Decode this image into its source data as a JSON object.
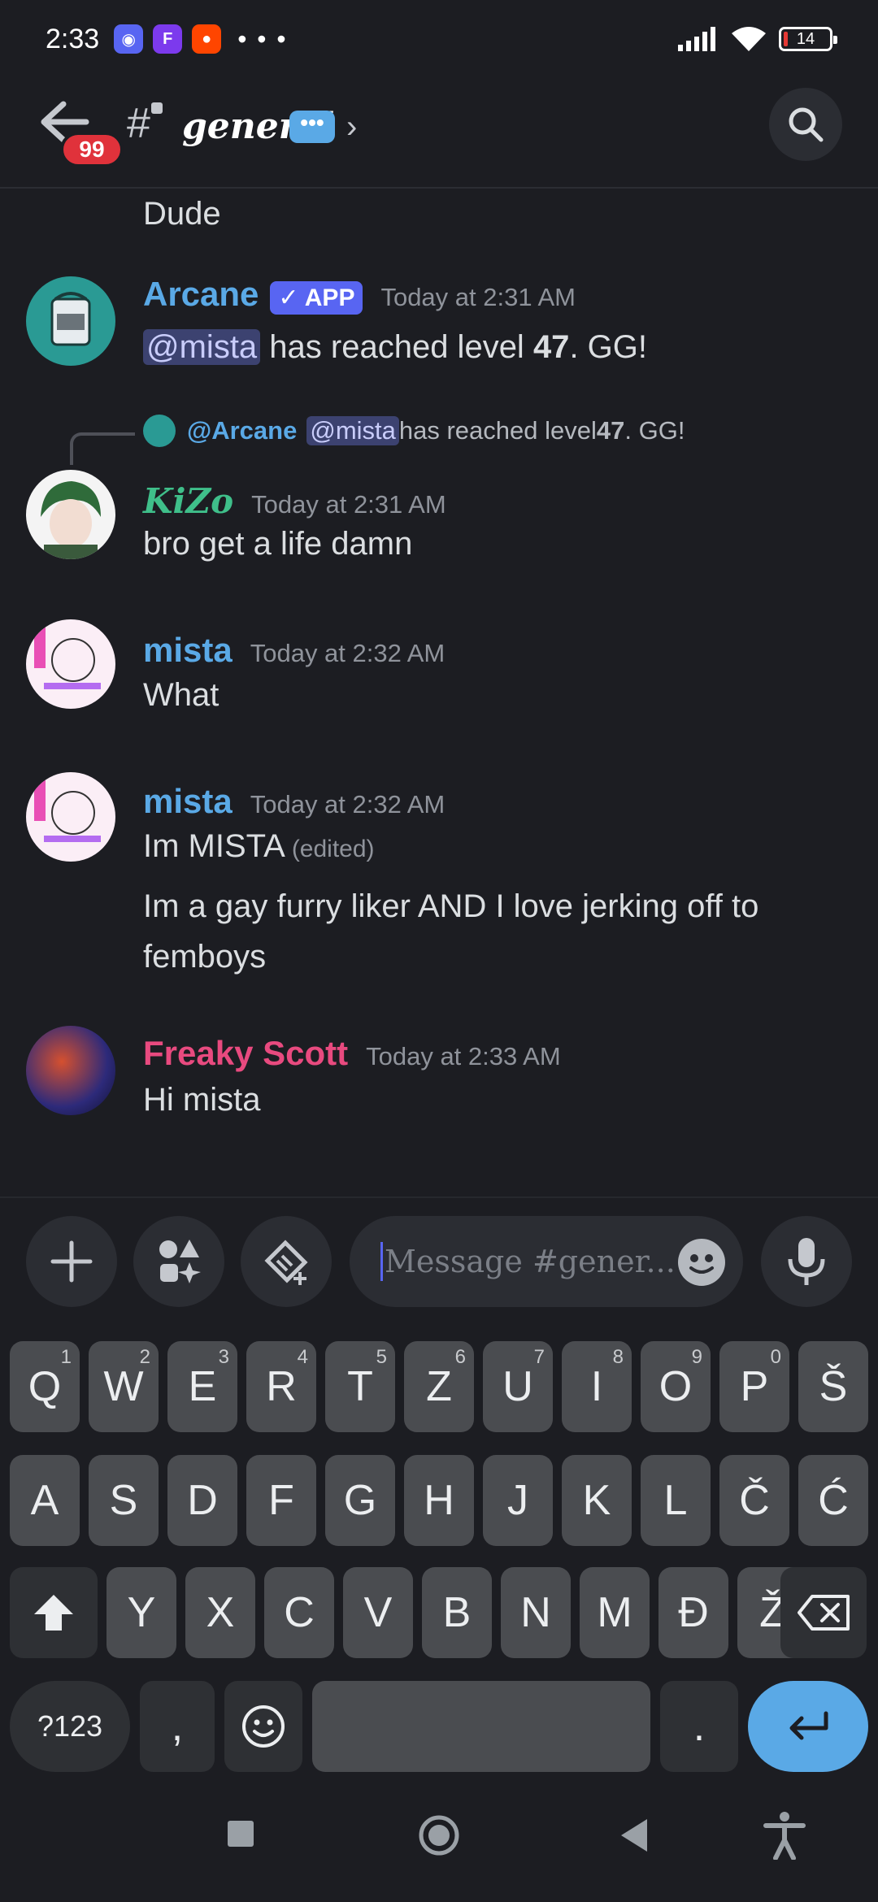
{
  "status_bar": {
    "time": "2:33",
    "apps": [
      {
        "icon": "discord-icon",
        "color": "#5865f2",
        "glyph": "◉"
      },
      {
        "icon": "fb-icon",
        "color": "#7c3aed",
        "glyph": "F"
      },
      {
        "icon": "reddit-icon",
        "color": "#ff4500",
        "glyph": "●"
      }
    ],
    "more": "• • •",
    "battery": "14"
  },
  "header": {
    "badge": "99",
    "channel": "general",
    "channel_emoji": "•••"
  },
  "messages": {
    "prev_tail": "Dude",
    "arcane": {
      "name": "Arcane",
      "tag": "✓ APP",
      "time": "Today at 2:31 AM",
      "mention": "@mista",
      "text_mid": " has reached level ",
      "level": "47",
      "text_end": ". GG!"
    },
    "reply": {
      "rname": "@Arcane",
      "mention": "@mista",
      "text_mid": " has reached level ",
      "level": "47",
      "text_end": ". GG!"
    },
    "kizo": {
      "name": "KiZo",
      "time": "Today at 2:31 AM",
      "text": "bro get a life damn"
    },
    "mista1": {
      "name": "mista",
      "time": "Today at 2:32 AM",
      "text": "What"
    },
    "mista2": {
      "name": "mista",
      "time": "Today at 2:32 AM",
      "line1": "Im MISTA",
      "edited": "(edited)",
      "line2": "Im a gay furry liker AND I love jerking off to",
      "line3": "femboys"
    },
    "scott": {
      "name": "Freaky Scott",
      "time": "Today at 2:33 AM",
      "text": "Hi mista"
    }
  },
  "composer": {
    "placeholder": "Message #gener..."
  },
  "keyboard": {
    "row1": [
      [
        "Q",
        "1"
      ],
      [
        "W",
        "2"
      ],
      [
        "E",
        "3"
      ],
      [
        "R",
        "4"
      ],
      [
        "T",
        "5"
      ],
      [
        "Z",
        "6"
      ],
      [
        "U",
        "7"
      ],
      [
        "I",
        "8"
      ],
      [
        "O",
        "9"
      ],
      [
        "P",
        "0"
      ],
      [
        "Š",
        ""
      ]
    ],
    "row2": [
      "A",
      "S",
      "D",
      "F",
      "G",
      "H",
      "J",
      "K",
      "L",
      "Č",
      "Ć"
    ],
    "row3": [
      "Y",
      "X",
      "C",
      "V",
      "B",
      "N",
      "M",
      "Đ",
      "Ž"
    ],
    "symbols": "?123",
    "comma": ",",
    "period": "."
  }
}
